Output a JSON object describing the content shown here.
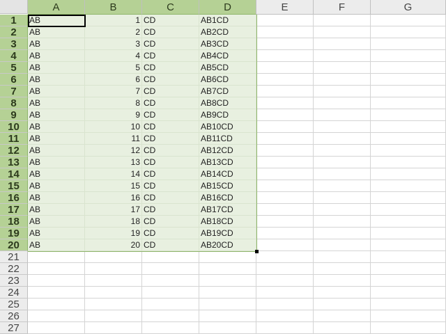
{
  "columns": [
    "A",
    "B",
    "C",
    "D",
    "E",
    "F",
    "G"
  ],
  "rows": [
    "1",
    "2",
    "3",
    "4",
    "5",
    "6",
    "7",
    "8",
    "9",
    "10",
    "11",
    "12",
    "13",
    "14",
    "15",
    "16",
    "17",
    "18",
    "19",
    "20",
    "21",
    "22",
    "23",
    "24",
    "25",
    "26",
    "27"
  ],
  "data_rows": [
    [
      "AB",
      "1",
      "CD",
      "AB1CD"
    ],
    [
      "AB",
      "2",
      "CD",
      "AB2CD"
    ],
    [
      "AB",
      "3",
      "CD",
      "AB3CD"
    ],
    [
      "AB",
      "4",
      "CD",
      "AB4CD"
    ],
    [
      "AB",
      "5",
      "CD",
      "AB5CD"
    ],
    [
      "AB",
      "6",
      "CD",
      "AB6CD"
    ],
    [
      "AB",
      "7",
      "CD",
      "AB7CD"
    ],
    [
      "AB",
      "8",
      "CD",
      "AB8CD"
    ],
    [
      "AB",
      "9",
      "CD",
      "AB9CD"
    ],
    [
      "AB",
      "10",
      "CD",
      "AB10CD"
    ],
    [
      "AB",
      "11",
      "CD",
      "AB11CD"
    ],
    [
      "AB",
      "12",
      "CD",
      "AB12CD"
    ],
    [
      "AB",
      "13",
      "CD",
      "AB13CD"
    ],
    [
      "AB",
      "14",
      "CD",
      "AB14CD"
    ],
    [
      "AB",
      "15",
      "CD",
      "AB15CD"
    ],
    [
      "AB",
      "16",
      "CD",
      "AB16CD"
    ],
    [
      "AB",
      "17",
      "CD",
      "AB17CD"
    ],
    [
      "AB",
      "18",
      "CD",
      "AB18CD"
    ],
    [
      "AB",
      "19",
      "CD",
      "AB19CD"
    ],
    [
      "AB",
      "20",
      "CD",
      "AB20CD"
    ]
  ],
  "selection": {
    "range": "A1:D20",
    "active_cell": "A1"
  },
  "colors": {
    "selection_header": "#b5d195",
    "selection_fill": "#e8f0e0",
    "header_bg": "#ececec"
  }
}
